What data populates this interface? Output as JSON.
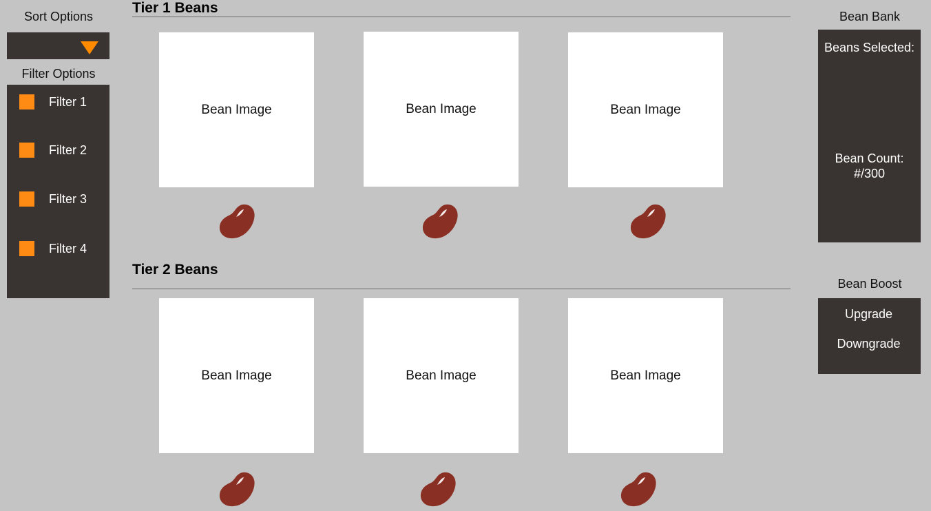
{
  "sidebar": {
    "sort_title": "Sort Options",
    "filter_title": "Filter Options",
    "filters": [
      {
        "label": "Filter 1"
      },
      {
        "label": "Filter 2"
      },
      {
        "label": "Filter 3"
      },
      {
        "label": "Filter 4"
      }
    ]
  },
  "tiers": [
    {
      "title": "Tier 1 Beans",
      "cards": [
        {
          "image_label": "Bean Image"
        },
        {
          "image_label": "Bean Image"
        },
        {
          "image_label": "Bean Image"
        }
      ]
    },
    {
      "title": "Tier 2 Beans",
      "cards": [
        {
          "image_label": "Bean Image"
        },
        {
          "image_label": "Bean Image"
        },
        {
          "image_label": "Bean Image"
        }
      ]
    }
  ],
  "bank": {
    "title": "Bean Bank",
    "beans_selected_label": "Beans Selected:",
    "bean_count_label": "Bean Count:",
    "bean_count_value": "#/300"
  },
  "boost": {
    "title": "Bean Boost",
    "upgrade_label": "Upgrade",
    "downgrade_label": "Downgrade"
  },
  "colors": {
    "background": "#c4c4c4",
    "panel": "#393431",
    "accent": "#ff8a14",
    "bean": "#8a2f24",
    "card": "#ffffff"
  },
  "icons": {
    "sort_dropdown": "triangle-down-icon",
    "filter_checkbox": "checkbox-icon",
    "bean": "bean-icon"
  }
}
